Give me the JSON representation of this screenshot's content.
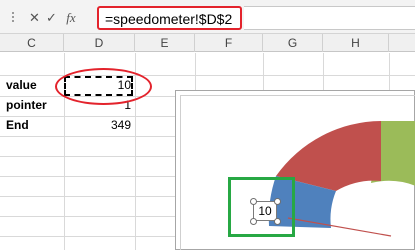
{
  "formula_bar": {
    "cancel_icon": "✕",
    "enter_icon": "✓",
    "fx_label": "fx",
    "formula": "=speedometer!$D$2"
  },
  "columns": [
    "C",
    "D",
    "E",
    "F",
    "G",
    "H"
  ],
  "rows": [
    {
      "label": "value",
      "value": "10"
    },
    {
      "label": "pointer",
      "value": "1"
    },
    {
      "label": "End",
      "value": "349"
    }
  ],
  "chart": {
    "data_label": "10",
    "colors": {
      "blue": "#4f81bd",
      "red": "#c0504d",
      "green": "#9bbb59",
      "pointer": "#c0504d"
    }
  },
  "annotation_colors": {
    "highlight_red": "#e3232c",
    "highlight_green": "#27a844"
  }
}
